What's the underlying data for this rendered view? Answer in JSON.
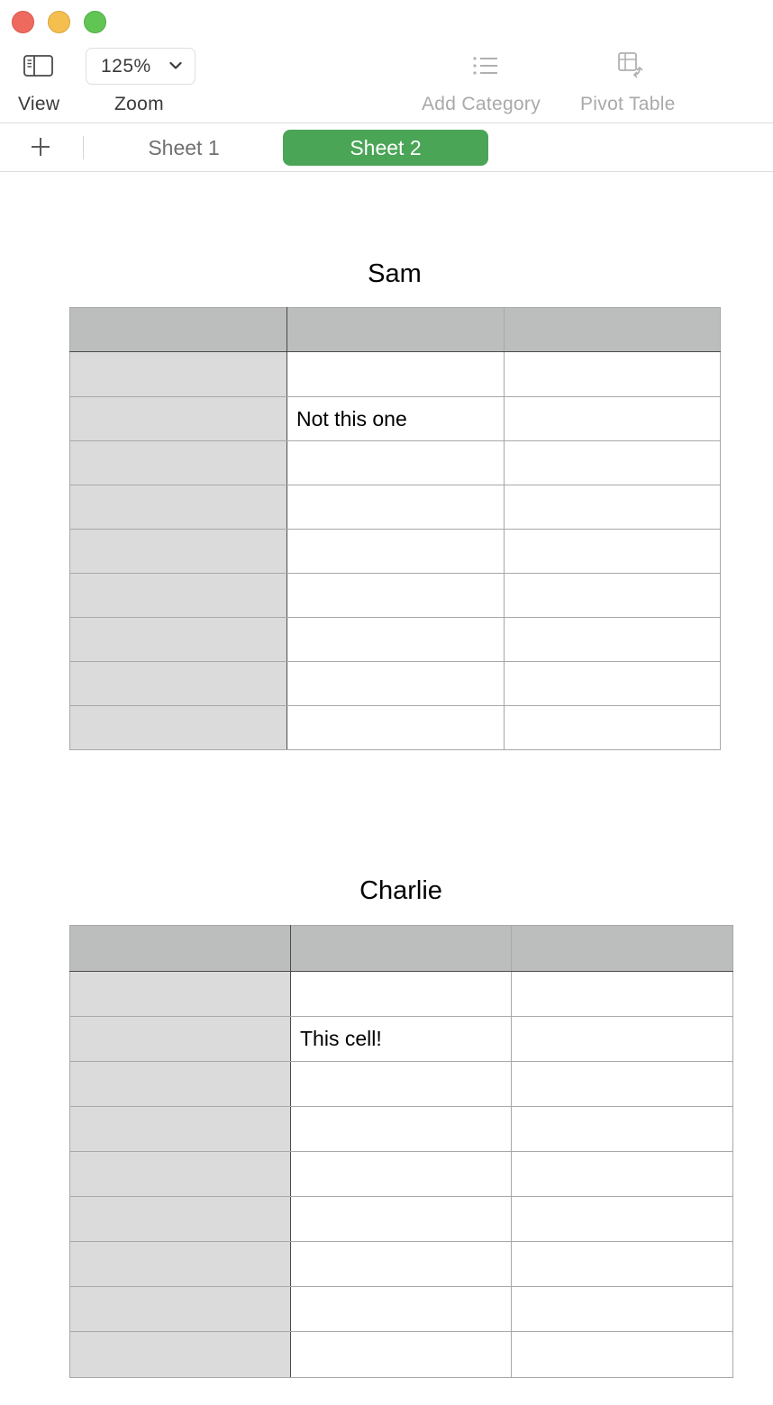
{
  "window": {
    "controls": [
      "close",
      "minimize",
      "maximize"
    ]
  },
  "toolbar": {
    "view_label": "View",
    "view_icon": "sidebar-icon",
    "zoom_value": "125%",
    "zoom_label": "Zoom",
    "add_category_label": "Add Category",
    "add_category_icon": "list-icon",
    "pivot_table_label": "Pivot Table",
    "pivot_table_icon": "pivot-table-icon"
  },
  "tabs": {
    "add_icon": "plus-icon",
    "items": [
      {
        "label": "Sheet 1",
        "active": false
      },
      {
        "label": "Sheet 2",
        "active": true
      }
    ],
    "active_color": "#4aa557"
  },
  "tables": [
    {
      "title": "Sam",
      "header": [
        "",
        "",
        ""
      ],
      "rows": [
        [
          "",
          "",
          ""
        ],
        [
          "",
          "Not this one",
          ""
        ],
        [
          "",
          "",
          ""
        ],
        [
          "",
          "",
          ""
        ],
        [
          "",
          "",
          ""
        ],
        [
          "",
          "",
          ""
        ],
        [
          "",
          "",
          ""
        ],
        [
          "",
          "",
          ""
        ],
        [
          "",
          "",
          ""
        ]
      ]
    },
    {
      "title": "Charlie",
      "header": [
        "",
        "",
        ""
      ],
      "rows": [
        [
          "",
          "",
          ""
        ],
        [
          "",
          "This cell!",
          ""
        ],
        [
          "",
          "",
          ""
        ],
        [
          "",
          "",
          ""
        ],
        [
          "",
          "",
          ""
        ],
        [
          "",
          "",
          ""
        ],
        [
          "",
          "",
          ""
        ],
        [
          "",
          "",
          ""
        ],
        [
          "",
          "",
          ""
        ]
      ]
    }
  ]
}
